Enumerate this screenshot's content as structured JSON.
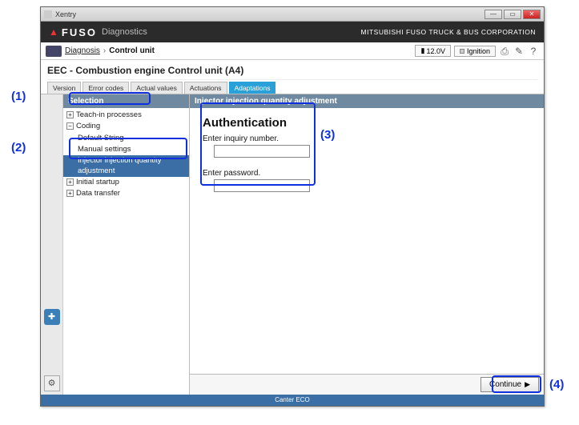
{
  "window": {
    "title": "Xentry"
  },
  "brand": {
    "name": "FUSO",
    "sub": "Diagnostics",
    "corp": "MITSUBISHI FUSO TRUCK & BUS CORPORATION"
  },
  "breadcrumb": {
    "link": "Diagnosis",
    "current": "Control unit"
  },
  "status": {
    "voltage": "12.0V",
    "ignition_label": "Ignition"
  },
  "ecu": {
    "title": "EEC - Combustion engine Control unit (A4)"
  },
  "tabs": [
    "Version",
    "Error codes",
    "Actual values",
    "Actuations",
    "Adaptations"
  ],
  "active_tab_index": 4,
  "left_panel": {
    "header": "Selection",
    "items": [
      {
        "label": "Teach-in processes",
        "expander": "+",
        "indent": 0
      },
      {
        "label": "Coding",
        "expander": "−",
        "indent": 0
      },
      {
        "label": "Default String",
        "indent": 1
      },
      {
        "label": "Manual settings",
        "indent": 1
      },
      {
        "label": "Injector injection quantity adjustment",
        "indent": 1,
        "selected": true
      },
      {
        "label": "Initial startup",
        "expander": "+",
        "indent": 0
      },
      {
        "label": "Data transfer",
        "expander": "+",
        "indent": 0
      }
    ]
  },
  "right_panel": {
    "header": "Injector injection quantity adjustment",
    "auth": {
      "title": "Authentication",
      "inquiry_label": "Enter inquiry number.",
      "inquiry_value": "",
      "password_label": "Enter password.",
      "password_value": ""
    }
  },
  "footer": {
    "continue": "Continue"
  },
  "statusbar": "Canter ECO",
  "annotations": [
    "(1)",
    "(2)",
    "(3)",
    "(4)"
  ]
}
